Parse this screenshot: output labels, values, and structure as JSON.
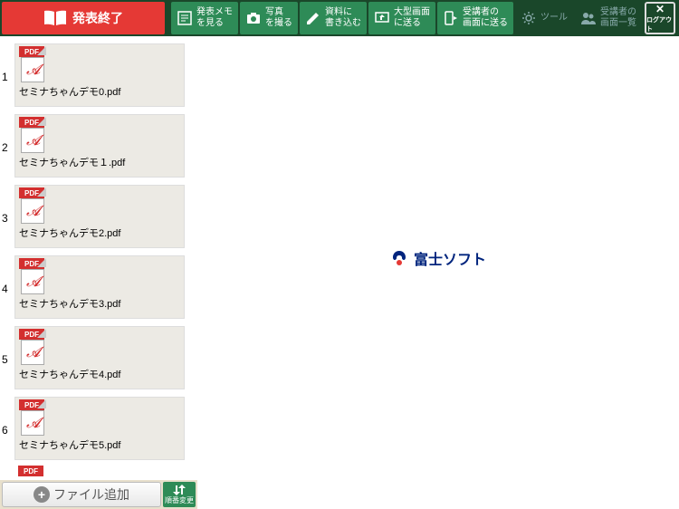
{
  "topbar": {
    "end_label": "発表終了",
    "buttons": [
      {
        "label": "発表メモ\nを見る"
      },
      {
        "label": "写真\nを撮る"
      },
      {
        "label": "資料に\n書き込む"
      },
      {
        "label": "大型画面\nに送る"
      },
      {
        "label": "受講者の\n画面に送る"
      }
    ],
    "tool_label": "ツール",
    "list_label": "受講者の\n画面一覧",
    "logout_label": "ログアウト"
  },
  "sidebar": {
    "files": [
      {
        "num": "1",
        "name": "セミナちゃんデモ0.pdf"
      },
      {
        "num": "2",
        "name": "セミナちゃんデモ１.pdf"
      },
      {
        "num": "3",
        "name": "セミナちゃんデモ2.pdf"
      },
      {
        "num": "4",
        "name": "セミナちゃんデモ3.pdf"
      },
      {
        "num": "5",
        "name": "セミナちゃんデモ4.pdf"
      },
      {
        "num": "6",
        "name": "セミナちゃんデモ5.pdf"
      }
    ],
    "pdf_badge": "PDF"
  },
  "bottom": {
    "add_label": "ファイル追加",
    "reorder_label": "順番変更"
  },
  "content": {
    "brand": "富士ソフト"
  }
}
